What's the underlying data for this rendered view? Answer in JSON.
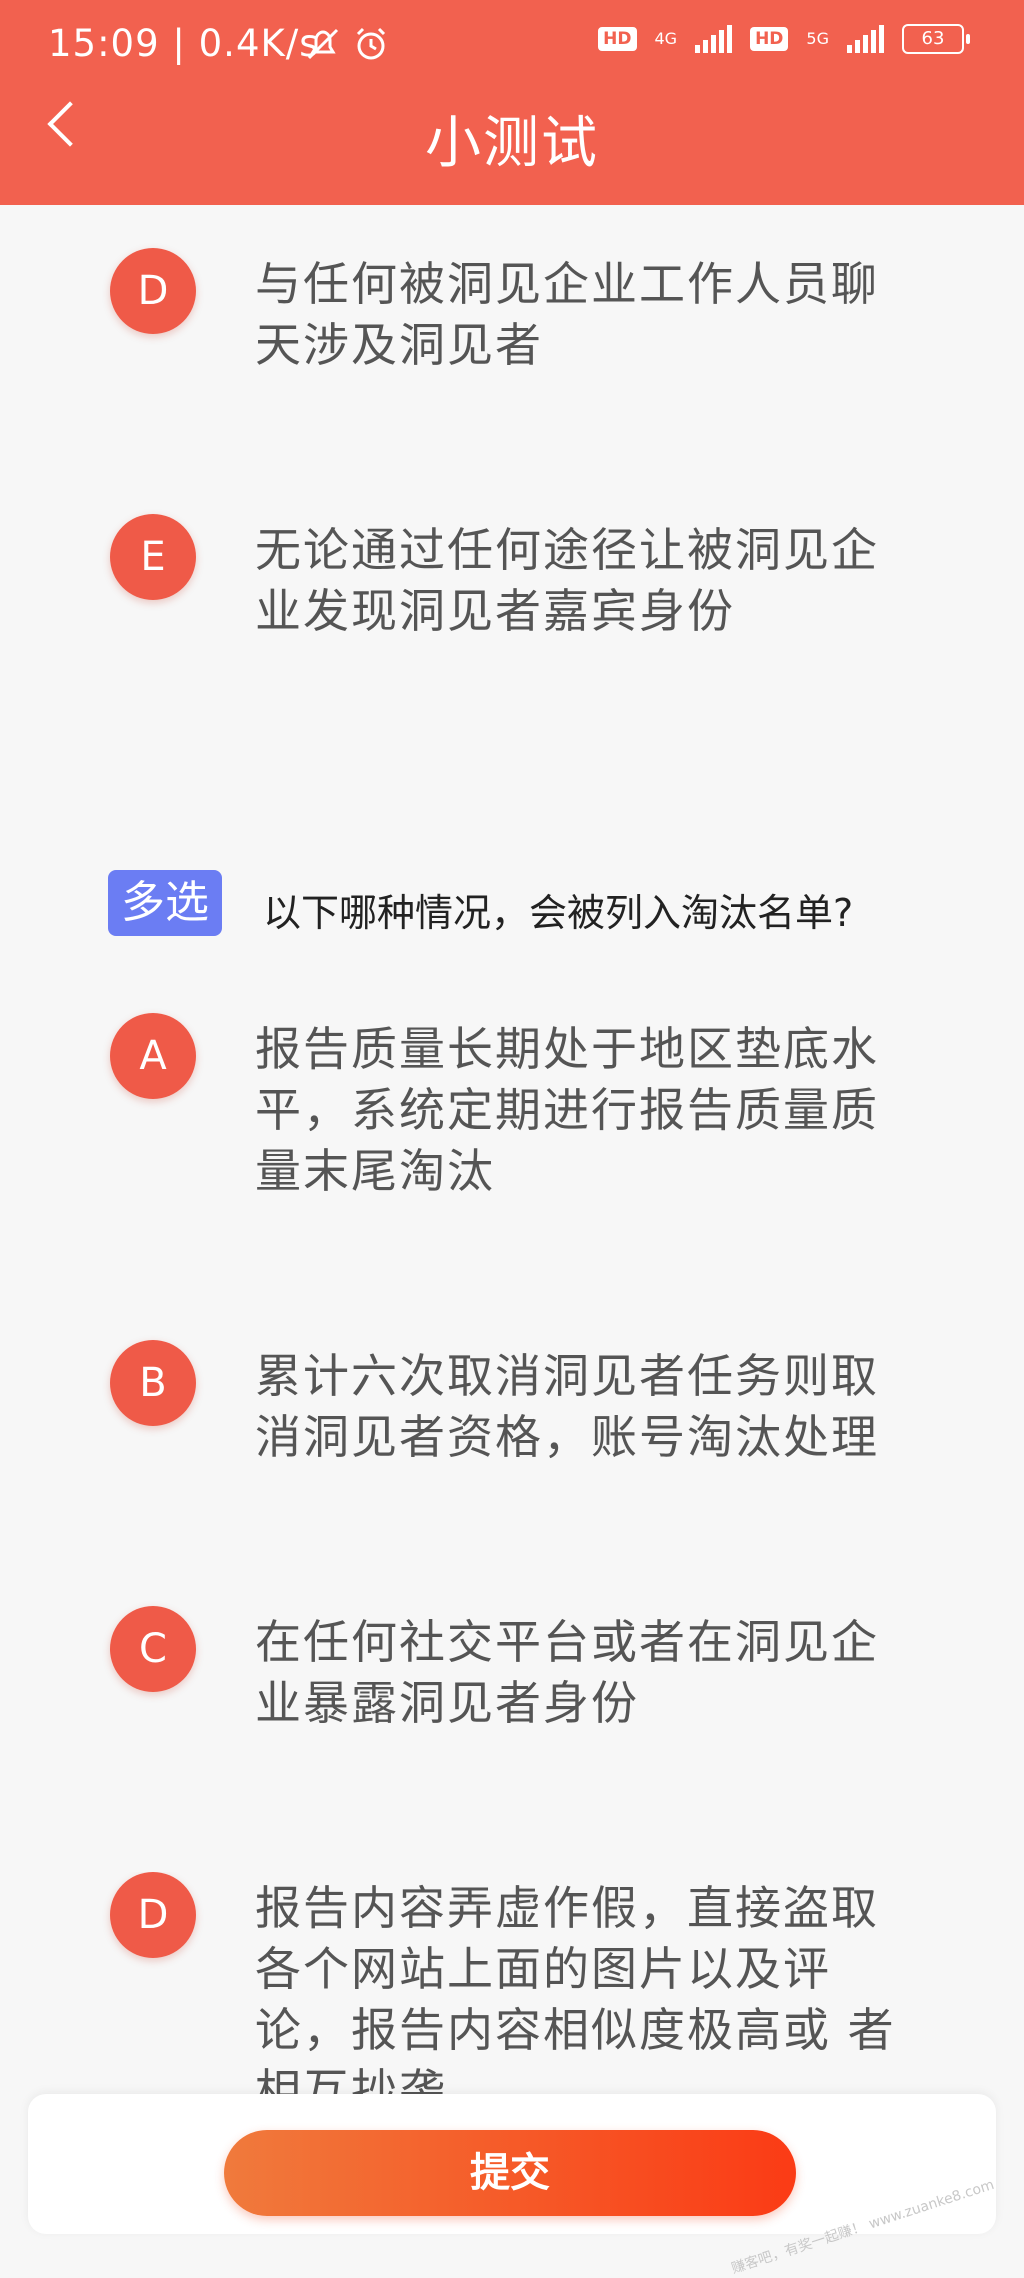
{
  "status": {
    "time": "15:09",
    "speed": "0.4K/s",
    "hd1": "HD",
    "net1": "4G",
    "hd2": "HD",
    "net2": "5G",
    "battery": "63"
  },
  "header": {
    "title": "小测试"
  },
  "prev_options": [
    {
      "letter": "D",
      "text": "与任何被洞见企业工作人员聊天涉及洞见者"
    },
    {
      "letter": "E",
      "text": "无论通过任何途径让被洞见企业发现洞见者嘉宾身份"
    }
  ],
  "question": {
    "badge": "多选",
    "text": "以下哪种情况，会被列入淘汰名单?"
  },
  "options": [
    {
      "letter": "A",
      "text": "报告质量长期处于地区垫底水平，系统定期进行报告质量质量末尾淘汰"
    },
    {
      "letter": "B",
      "text": "累计六次取消洞见者任务则取消洞见者资格，账号淘汰处理"
    },
    {
      "letter": "C",
      "text": "在任何社交平台或者在洞见企业暴露洞见者身份"
    },
    {
      "letter": "D",
      "text": "报告内容弄虚作假，直接盗取各个网站上面的图片以及评论，报告内容相似度极高或 者相互抄袭"
    }
  ],
  "footer": {
    "submit_label": "提交"
  },
  "watermark": "赚客吧，有奖一起赚！ www.zuanke8.com"
}
